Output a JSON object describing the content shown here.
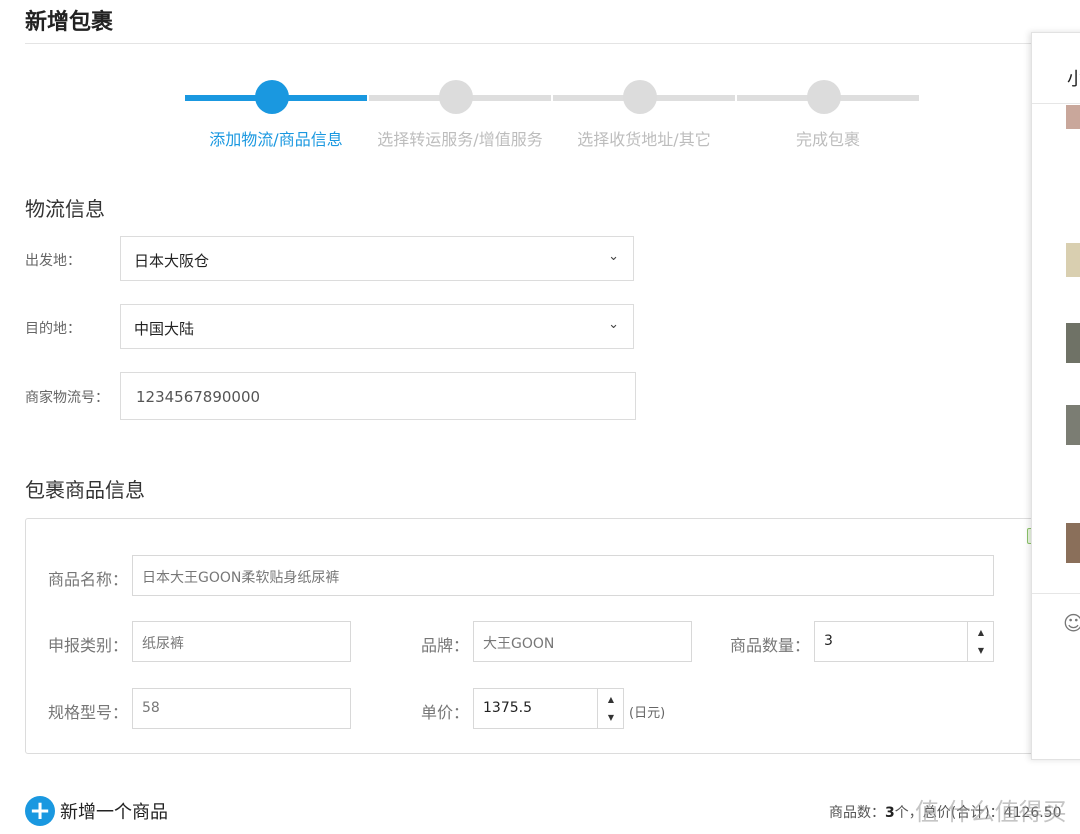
{
  "page": {
    "title": "新增包裹"
  },
  "steps": [
    {
      "label": "添加物流/商品信息",
      "state": "active"
    },
    {
      "label": "选择转运服务/增值服务",
      "state": "inactive"
    },
    {
      "label": "选择收货地址/其它",
      "state": "inactive"
    },
    {
      "label": "完成包裹",
      "state": "inactive"
    }
  ],
  "logistics": {
    "section_title": "物流信息",
    "origin_label": "出发地：",
    "origin_value": "日本大阪仓",
    "destination_label": "目的地：",
    "destination_value": "中国大陆",
    "tracking_label": "商家物流号：",
    "tracking_value": "1234567890000"
  },
  "goods": {
    "section_title": "包裹商品信息",
    "name_label": "商品名称：",
    "name_value": "日本大王GOON柔软贴身纸尿裤",
    "category_label": "申报类别：",
    "category_value": "纸尿裤",
    "brand_label": "品牌：",
    "brand_value": "大王GOON",
    "quantity_label": "商品数量：",
    "quantity_value": "3",
    "spec_label": "规格型号：",
    "spec_value": "58",
    "price_label": "单价：",
    "price_value": "1375.5",
    "price_unit": "(日元)"
  },
  "actions": {
    "add_item_label": "新增一个商品"
  },
  "summary": {
    "count_label": "商品数：",
    "count_value": "3",
    "rest": "个，总价(合计)：4126.50"
  },
  "side_panel": {
    "head": "小"
  },
  "watermark": "值 什么值得买",
  "colors": {
    "accent": "#1a98e0",
    "inactive": "#dcdcdc"
  },
  "icons": {
    "select": "chevron-down-icon",
    "add": "plus-circle-icon",
    "emoji": "smile-icon"
  }
}
